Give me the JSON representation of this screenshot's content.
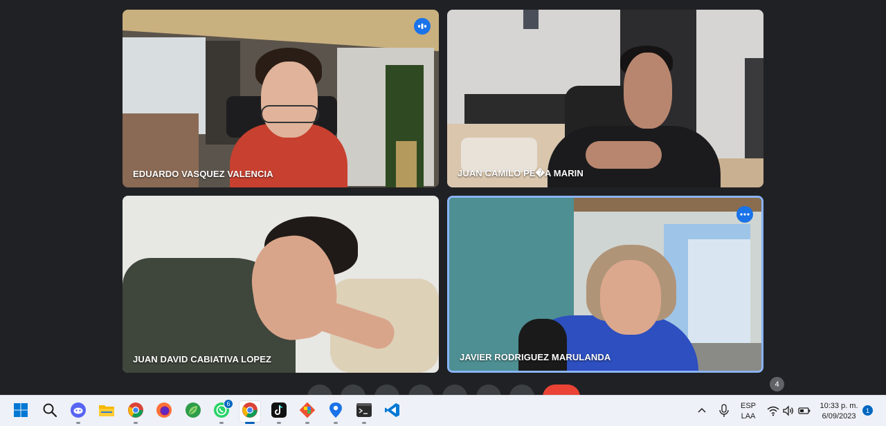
{
  "meeting": {
    "participants": [
      {
        "name": "EDUARDO VASQUEZ VALENCIA",
        "badge": "speaking-icon"
      },
      {
        "name": "JUAN CAMILO PE\u0000A MARIN"
      },
      {
        "name": "JUAN DAVID CABIATIVA LOPEZ"
      },
      {
        "name": "JAVIER RODRIGUEZ MARULANDA",
        "badge": "more-options-icon"
      }
    ],
    "people_count": "4",
    "meeting_code": "",
    "colors": {
      "background": "#202124",
      "active_border": "#8ab4f8",
      "leave": "#ea4335",
      "badge": "#1a73e8"
    }
  },
  "taskbar": {
    "apps": [
      {
        "name": "start-icon"
      },
      {
        "name": "search-icon"
      },
      {
        "name": "discord-icon"
      },
      {
        "name": "file-explorer-icon"
      },
      {
        "name": "chrome-icon"
      },
      {
        "name": "firefox-icon"
      },
      {
        "name": "leaf-app-icon"
      },
      {
        "name": "whatsapp-icon",
        "badge": "6"
      },
      {
        "name": "chrome-icon",
        "active": true
      },
      {
        "name": "tiktok-icon"
      },
      {
        "name": "git-icon"
      },
      {
        "name": "maps-pin-icon"
      },
      {
        "name": "terminal-icon"
      },
      {
        "name": "vscode-icon"
      }
    ],
    "tray": {
      "language_line1": "ESP",
      "language_line2": "LAA",
      "time": "10:33 p. m.",
      "date": "6/09/2023",
      "notifications": "1"
    }
  }
}
